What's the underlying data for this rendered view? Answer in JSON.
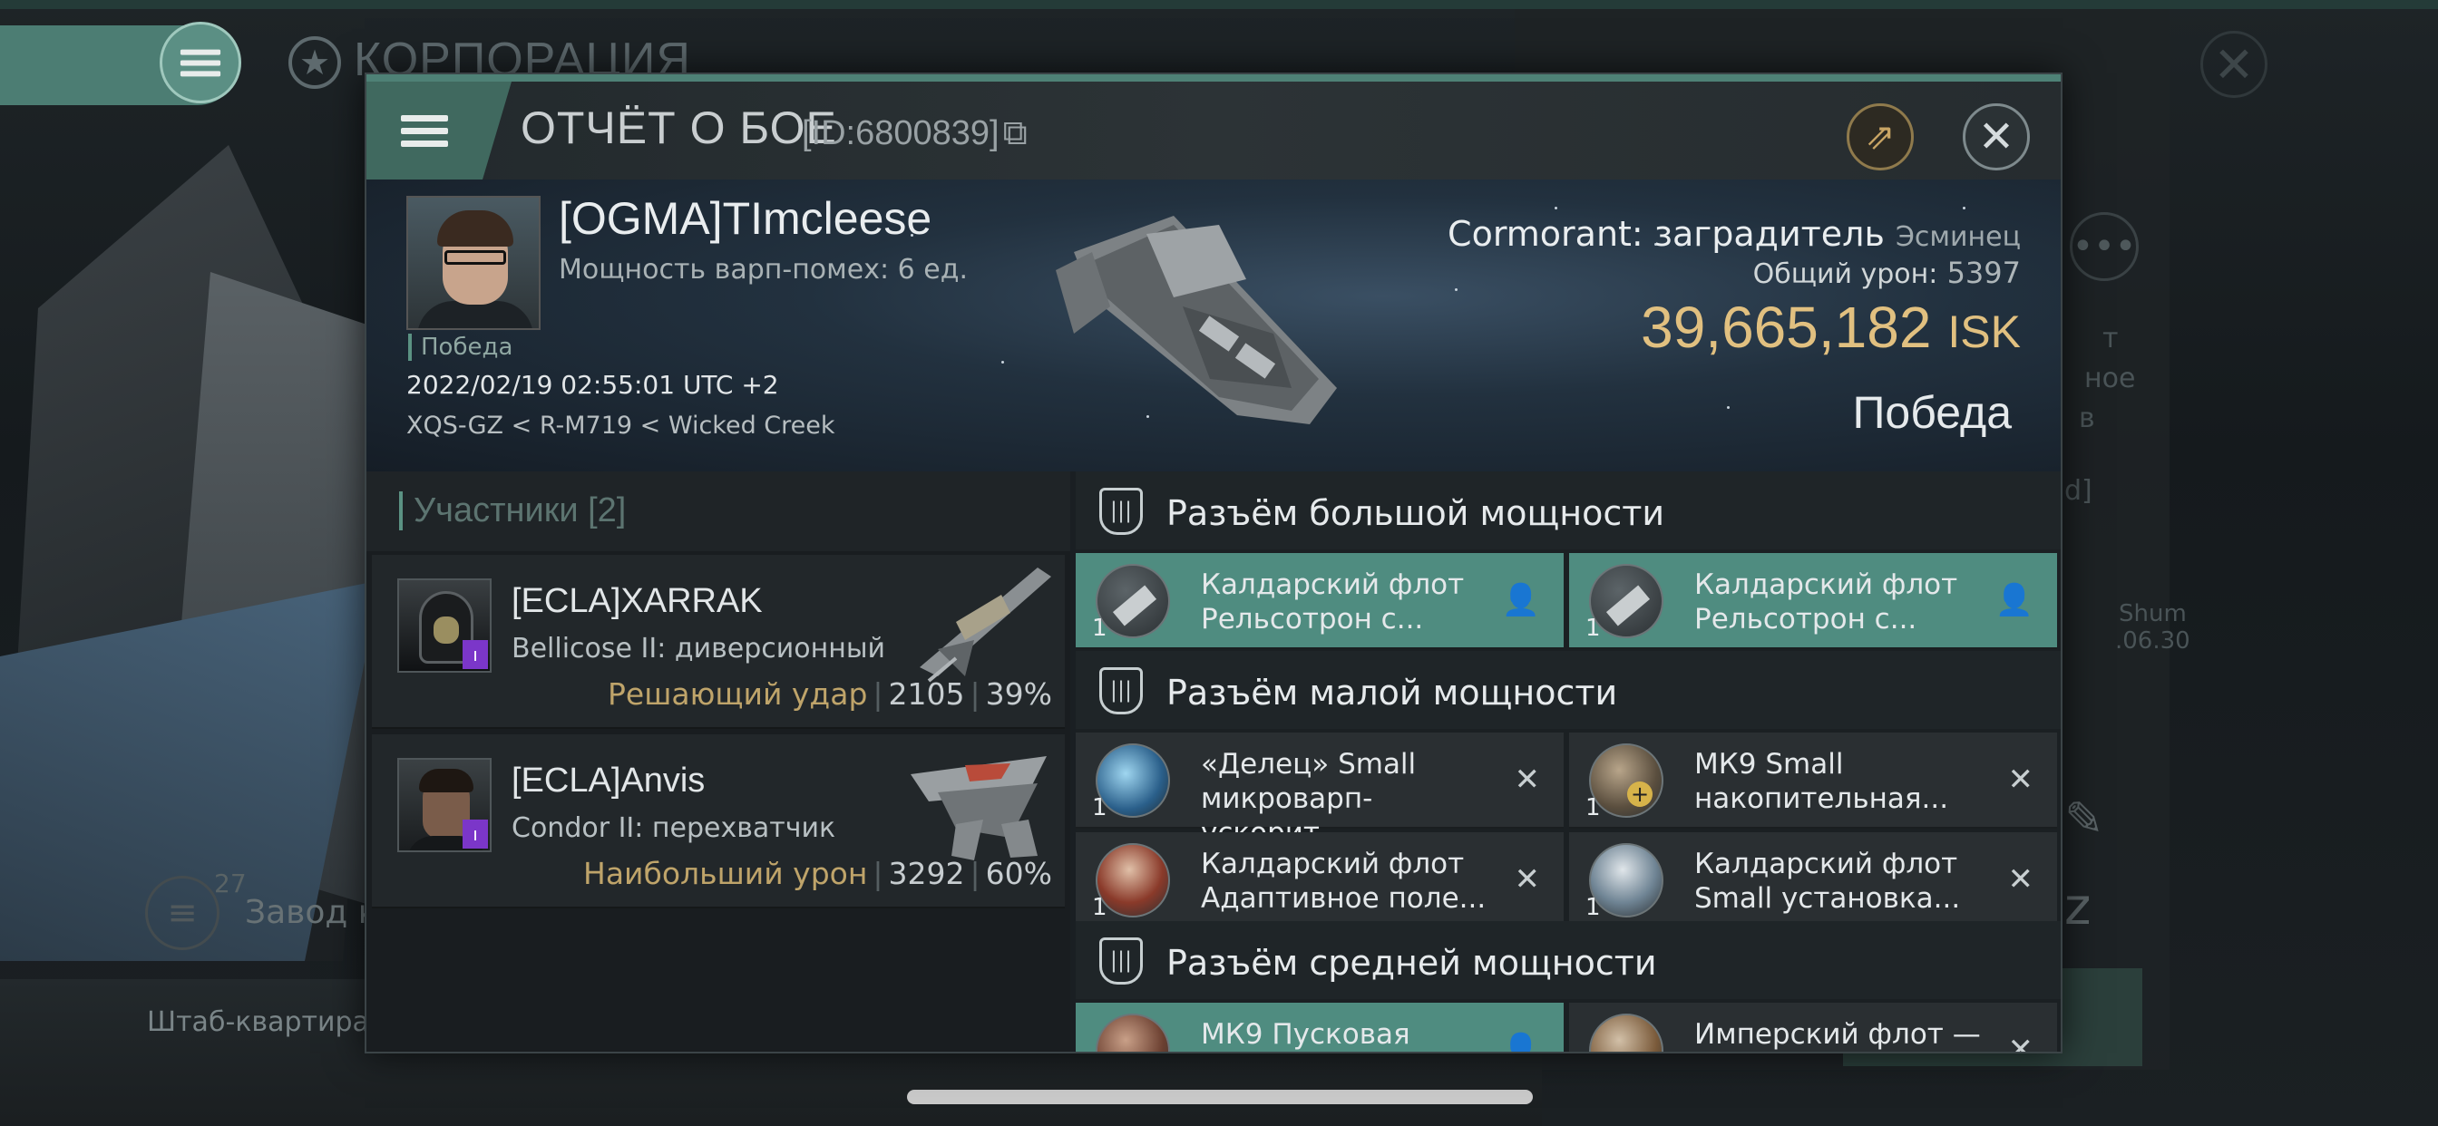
{
  "background": {
    "corp_title": "КОРПОРАЦИЯ",
    "factory_label": "Завод к",
    "factory_count": "27",
    "hq_label": "Штаб-квартира К",
    "side_texts": [
      "т",
      "ное",
      "в",
      "d]",
      "Shum",
      ".06.30"
    ]
  },
  "dialog": {
    "title": "ОТЧЁТ О БОЕ",
    "report_id": "[ID:6800839]"
  },
  "banner": {
    "pilot_name": "[OGMA]TImcleese",
    "warp_info": "Мощность варп-помех: 6 ед.",
    "status_tag": "Победа",
    "datetime": "2022/02/19 02:55:01 UTC +2",
    "location": "XQS-GZ < R-M719 < Wicked Creek",
    "ship_name": "Cormorant: заградитель",
    "ship_class": "Эсминец",
    "total_damage_label": "Общий урон:",
    "total_damage": "5397",
    "isk_value": "39,665,182",
    "isk_currency": "ISK",
    "result": "Победа"
  },
  "participants": {
    "title": "Участники [2]",
    "rows": [
      {
        "name": "[ECLA]XARRAK",
        "ship": "Bellicose II: диверсионный",
        "tag": "Решающий удар",
        "damage": "2105",
        "percent": "39%"
      },
      {
        "name": "[ECLA]Anvis",
        "ship": "Condor II: перехватчик",
        "tag": "Наибольший урон",
        "damage": "3292",
        "percent": "60%"
      }
    ]
  },
  "fittings": {
    "high_title": "Разъём большой мощности",
    "low_title": "Разъём малой мощности",
    "mid_title": "Разъём средней мощности",
    "high": [
      {
        "line1": "Калдарский флот",
        "line2": "Рельсотрон с...",
        "qty": "1",
        "icon": "railgun-icon",
        "status": "user-icon"
      },
      {
        "line1": "Калдарский флот",
        "line2": "Рельсотрон с...",
        "qty": "1",
        "icon": "railgun-icon",
        "status": "user-icon"
      }
    ],
    "low": [
      {
        "line1": "«Делец» Small",
        "line2": "микроварп-ускорит....",
        "qty": "1",
        "icon": "microwarp-icon",
        "status": "x"
      },
      {
        "line1": "МК9 Small",
        "line2": "накопительная...",
        "qty": "1",
        "icon": "capacitor-icon",
        "status": "x"
      },
      {
        "line1": "Калдарский флот",
        "line2": "Адаптивное поле...",
        "qty": "1",
        "icon": "shield-field-icon",
        "status": "x"
      },
      {
        "line1": "Калдарский флот",
        "line2": "Small установка...",
        "qty": "1",
        "icon": "shield-extender-icon",
        "status": "x"
      }
    ],
    "mid": [
      {
        "line1": "МК9 Пусковая",
        "line2": "",
        "icon": "launcher-icon",
        "status": "user-icon"
      },
      {
        "line1": "Имперский флот —",
        "line2": "",
        "icon": "module-icon",
        "status": "x"
      }
    ]
  },
  "colors": {
    "accent_teal": "#4f8c80",
    "isk_gold": "#e1c080",
    "tag_gold": "#bfa46a",
    "badge_purple": "#7b36c9"
  }
}
